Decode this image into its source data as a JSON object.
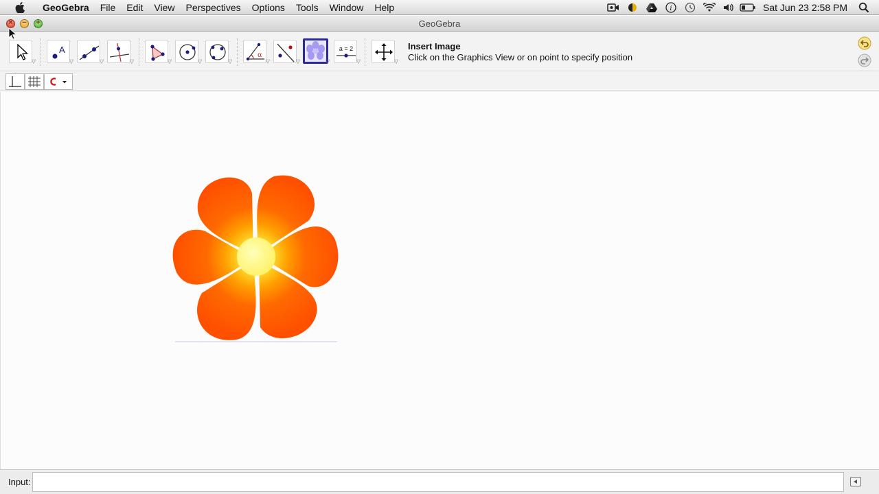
{
  "menubar": {
    "apple_icon": "apple-icon",
    "app_name": "GeoGebra",
    "items": [
      "File",
      "Edit",
      "View",
      "Perspectives",
      "Options",
      "Tools",
      "Window",
      "Help"
    ],
    "status_icons": [
      "screen-recorder-icon",
      "coin-icon",
      "google-drive-icon",
      "info-icon",
      "time-machine-icon",
      "wifi-icon",
      "volume-icon",
      "battery-icon"
    ],
    "clock": "Sat Jun 23  2:58 PM",
    "search_icon": "spotlight-search-icon"
  },
  "window": {
    "title": "GeoGebra"
  },
  "toolbar": {
    "tools": [
      {
        "name": "move-tool",
        "icon": "arrow-pointer-icon"
      },
      {
        "name": "point-tool",
        "icon": "new-point-icon"
      },
      {
        "name": "line-tool",
        "icon": "line-through-two-points-icon"
      },
      {
        "name": "perpendicular-line-tool",
        "icon": "perpendicular-line-icon"
      },
      {
        "name": "polygon-tool",
        "icon": "polygon-icon"
      },
      {
        "name": "circle-center-point-tool",
        "icon": "circle-center-point-icon"
      },
      {
        "name": "circle-three-points-tool",
        "icon": "circle-three-points-icon"
      },
      {
        "name": "angle-tool",
        "icon": "angle-icon"
      },
      {
        "name": "reflect-tool",
        "icon": "reflect-about-line-icon"
      },
      {
        "name": "insert-image-tool",
        "icon": "insert-image-icon",
        "selected": true
      },
      {
        "name": "slider-tool",
        "icon": "slider-icon",
        "label": "a = 2"
      },
      {
        "name": "move-graphics-view-tool",
        "icon": "move-graphics-view-icon"
      }
    ],
    "help_title": "Insert Image",
    "help_text": "Click on the Graphics View or on point to specify position",
    "undo_icon": "undo-icon",
    "redo_icon": "redo-icon"
  },
  "stylebar": {
    "buttons": [
      "show-axes-icon",
      "show-grid-icon",
      "point-capturing-icon"
    ]
  },
  "graphics": {
    "image_icon": "flower-image"
  },
  "inputbar": {
    "label": "Input:",
    "value": "",
    "help_icon": "input-help-icon"
  },
  "colors": {
    "selected_tool_border": "#2a2a9a",
    "petal": "#ff5a00",
    "center": "#fff980"
  }
}
